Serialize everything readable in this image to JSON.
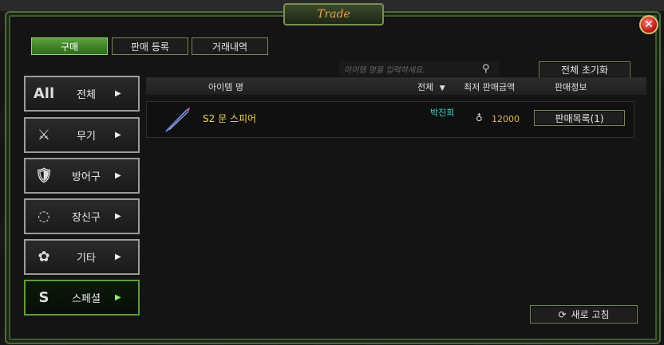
{
  "title": "Trade",
  "close_glyph": "✕",
  "tabs": [
    {
      "label": "구매",
      "active": true
    },
    {
      "label": "판매 등록",
      "active": false
    },
    {
      "label": "거래내역",
      "active": false
    }
  ],
  "search": {
    "placeholder": "아이템 명을 입력하세요.",
    "icon": "search-icon"
  },
  "reset_all_label": "전체 초기화",
  "categories": [
    {
      "icon": "All",
      "label": "전체",
      "active": false
    },
    {
      "icon": "⚔",
      "label": "무기",
      "active": false
    },
    {
      "icon": "🛡",
      "label": "방어구",
      "active": false
    },
    {
      "icon": "◌",
      "label": "장신구",
      "active": false
    },
    {
      "icon": "✿",
      "label": "기타",
      "active": false
    },
    {
      "icon": "S",
      "label": "스페셜",
      "active": true
    }
  ],
  "table": {
    "headers": {
      "name": "아이템 명",
      "filter": "전체",
      "filter_arrow": "▼",
      "lowest_price": "최저 판매금액",
      "sale_info": "판매정보"
    },
    "rows": [
      {
        "name": "S2 문 스피어",
        "seller": "박진희",
        "price": "12000",
        "list_button": "판매목록(1)"
      }
    ]
  },
  "refresh_label": "새로 고침",
  "colors": {
    "accent_green": "#5aa13a",
    "item_name": "#f0d75a",
    "seller": "#3fd6c8",
    "price": "#e2b65e"
  }
}
